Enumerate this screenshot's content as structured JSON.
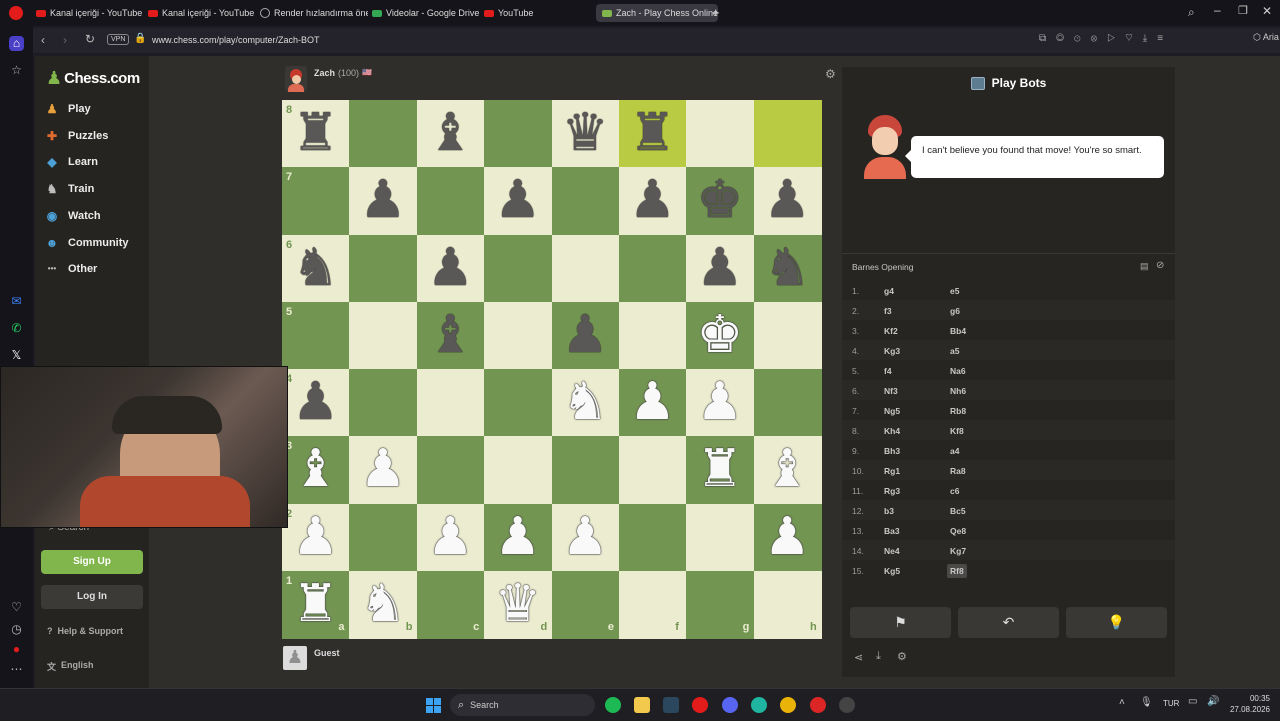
{
  "browser": {
    "tabs": [
      {
        "label": "Kanal içeriği - YouTube Stu",
        "type": "youtube"
      },
      {
        "label": "Kanal içeriği - YouTube Stu",
        "type": "youtube"
      },
      {
        "label": "Render hızlandırma önerile",
        "type": "loading"
      },
      {
        "label": "Videolar - Google Drive",
        "type": "drive"
      },
      {
        "label": "YouTube",
        "type": "youtube"
      },
      {
        "label": "Zach - Play Chess Online",
        "type": "chess",
        "active": true
      }
    ],
    "url": "www.chess.com/play/computer/Zach-BOT",
    "vpn_label": "VPN",
    "ai_label": "Aria"
  },
  "nav": {
    "logo": "Chess.com",
    "items": [
      {
        "label": "Play",
        "icon": "play-icon",
        "color": "#e8a13a"
      },
      {
        "label": "Puzzles",
        "icon": "puzzle-icon",
        "color": "#e16a2f"
      },
      {
        "label": "Learn",
        "icon": "learn-icon",
        "color": "#4ca2d8"
      },
      {
        "label": "Train",
        "icon": "train-icon",
        "color": "#bdbdbd"
      },
      {
        "label": "Watch",
        "icon": "watch-icon",
        "color": "#4ca2d8"
      },
      {
        "label": "Community",
        "icon": "community-icon",
        "color": "#4ca2d8"
      },
      {
        "label": "Other",
        "icon": "other-icon",
        "color": "#bdbdbd"
      }
    ],
    "search_placeholder": "Search",
    "signup_label": "Sign Up",
    "login_label": "Log In",
    "help_label": "Help & Support",
    "language_label": "English"
  },
  "opponent": {
    "name": "Zach",
    "rating": "(100)",
    "flag": "🇺🇸"
  },
  "player": {
    "name": "Guest"
  },
  "board": {
    "ranks": [
      "8",
      "7",
      "6",
      "5",
      "4",
      "3",
      "2",
      "1"
    ],
    "files": [
      "a",
      "b",
      "c",
      "d",
      "e",
      "f",
      "g",
      "h"
    ],
    "light_color": "#ebecd0",
    "dark_color": "#739552",
    "highlight_squares": [
      "f8",
      "h8"
    ],
    "position": [
      [
        "r",
        "",
        "b",
        "",
        "q",
        "r",
        "",
        ""
      ],
      [
        "",
        "p",
        "",
        "p",
        "",
        "p",
        "k",
        "p"
      ],
      [
        "n",
        "",
        "p",
        "",
        "",
        "",
        "p",
        "n"
      ],
      [
        "",
        "",
        "b",
        "",
        "p",
        "",
        "K",
        ""
      ],
      [
        "p",
        "",
        "",
        "",
        "N",
        "P",
        "P",
        ""
      ],
      [
        "B",
        "P",
        "",
        "",
        "",
        "",
        "R",
        "B"
      ],
      [
        "P",
        "",
        "P",
        "P",
        "P",
        "",
        "",
        "P"
      ],
      [
        "R",
        "N",
        "",
        "Q",
        "",
        "",
        "",
        ""
      ]
    ]
  },
  "panel": {
    "title": "Play Bots",
    "speech": "I can't believe you found that move! You're so smart.",
    "opening": "Barnes Opening",
    "moves": [
      {
        "n": "1.",
        "w": "g4",
        "b": "e5"
      },
      {
        "n": "2.",
        "w": "f3",
        "b": "g6"
      },
      {
        "n": "3.",
        "w": "Kf2",
        "b": "Bb4"
      },
      {
        "n": "4.",
        "w": "Kg3",
        "b": "a5"
      },
      {
        "n": "5.",
        "w": "f4",
        "b": "Na6"
      },
      {
        "n": "6.",
        "w": "Nf3",
        "b": "Nh6"
      },
      {
        "n": "7.",
        "w": "Ng5",
        "b": "Rb8"
      },
      {
        "n": "8.",
        "w": "Kh4",
        "b": "Kf8"
      },
      {
        "n": "9.",
        "w": "Bh3",
        "b": "a4"
      },
      {
        "n": "10.",
        "w": "Rg1",
        "b": "Ra8"
      },
      {
        "n": "11.",
        "w": "Rg3",
        "b": "c6"
      },
      {
        "n": "12.",
        "w": "b3",
        "b": "Bc5"
      },
      {
        "n": "13.",
        "w": "Ba3",
        "b": "Qe8"
      },
      {
        "n": "14.",
        "w": "Ne4",
        "b": "Kg7"
      },
      {
        "n": "15.",
        "w": "Kg5",
        "b": "Rf8"
      }
    ]
  },
  "taskbar": {
    "search_label": "Search",
    "lang": "TUR",
    "time": "00:35",
    "date": "27.08.2026"
  }
}
